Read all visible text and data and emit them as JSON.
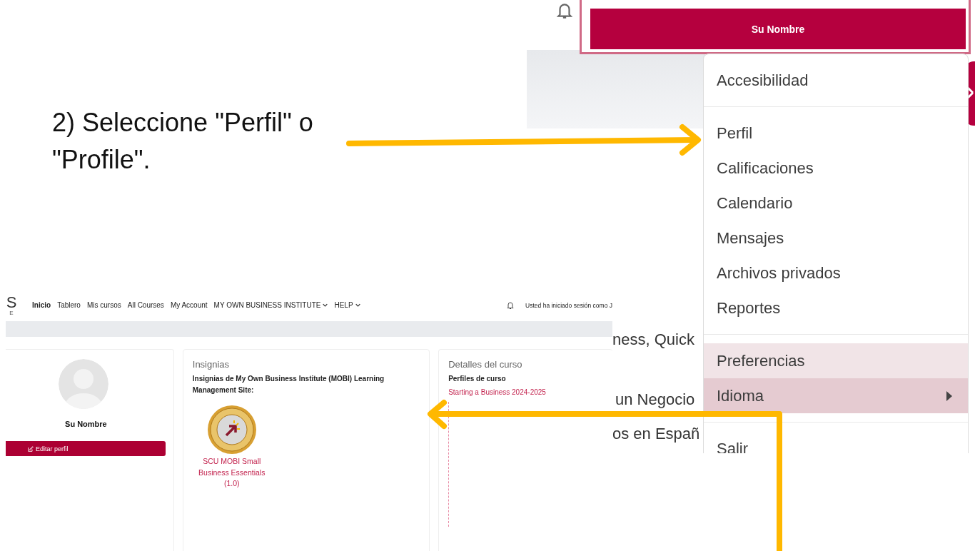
{
  "instruction": {
    "text": "2) Seleccione \"Perfil\" o \"Profile\"."
  },
  "user_menu": {
    "header": "Su Nombre",
    "groups": [
      [
        {
          "label": "Accesibilidad",
          "highlighted": false,
          "selected": false,
          "submenu": false
        }
      ],
      [
        {
          "label": "Perfil",
          "highlighted": false,
          "selected": false,
          "submenu": false
        },
        {
          "label": "Calificaciones",
          "highlighted": false,
          "selected": false,
          "submenu": false
        },
        {
          "label": "Calendario",
          "highlighted": false,
          "selected": false,
          "submenu": false
        },
        {
          "label": "Mensajes",
          "highlighted": false,
          "selected": false,
          "submenu": false
        },
        {
          "label": "Archivos privados",
          "highlighted": false,
          "selected": false,
          "submenu": false
        },
        {
          "label": "Reportes",
          "highlighted": false,
          "selected": false,
          "submenu": false
        }
      ],
      [
        {
          "label": "Preferencias",
          "highlighted": true,
          "selected": false,
          "submenu": false
        },
        {
          "label": "Idioma",
          "highlighted": true,
          "selected": true,
          "submenu": true
        }
      ],
      [
        {
          "label": "Salir",
          "highlighted": false,
          "selected": false,
          "submenu": false
        }
      ]
    ]
  },
  "background_text": [
    "ness, Quick",
    "un Negocio",
    "os en Españ"
  ],
  "site": {
    "logo": {
      "letter": "S",
      "sub": "E"
    },
    "nav": [
      {
        "label": "Inicio",
        "selected": true,
        "dropdown": false
      },
      {
        "label": "Tablero",
        "selected": false,
        "dropdown": false
      },
      {
        "label": "Mis cursos",
        "selected": false,
        "dropdown": false
      },
      {
        "label": "All Courses",
        "selected": false,
        "dropdown": false
      },
      {
        "label": "My Account",
        "selected": false,
        "dropdown": false
      },
      {
        "label": "MY OWN BUSINESS INSTITUTE",
        "selected": false,
        "dropdown": true
      },
      {
        "label": "HELP",
        "selected": false,
        "dropdown": true
      }
    ],
    "login_text": "Usted ha iniciado sesión como J",
    "profile_card": {
      "name": "Su Nombre",
      "button": "Editar perfil"
    },
    "badges_card": {
      "title": "Insignias",
      "heading": "Insignias de My Own Business Institute (MOBI) Learning Management Site:",
      "badges": [
        {
          "name": "SCU MOBI Small Business Essentials (1.0)"
        }
      ]
    },
    "course_card": {
      "title": "Detalles del curso",
      "heading": "Perfiles de curso",
      "courses": [
        "Starting a Business 2024-2025"
      ]
    }
  }
}
